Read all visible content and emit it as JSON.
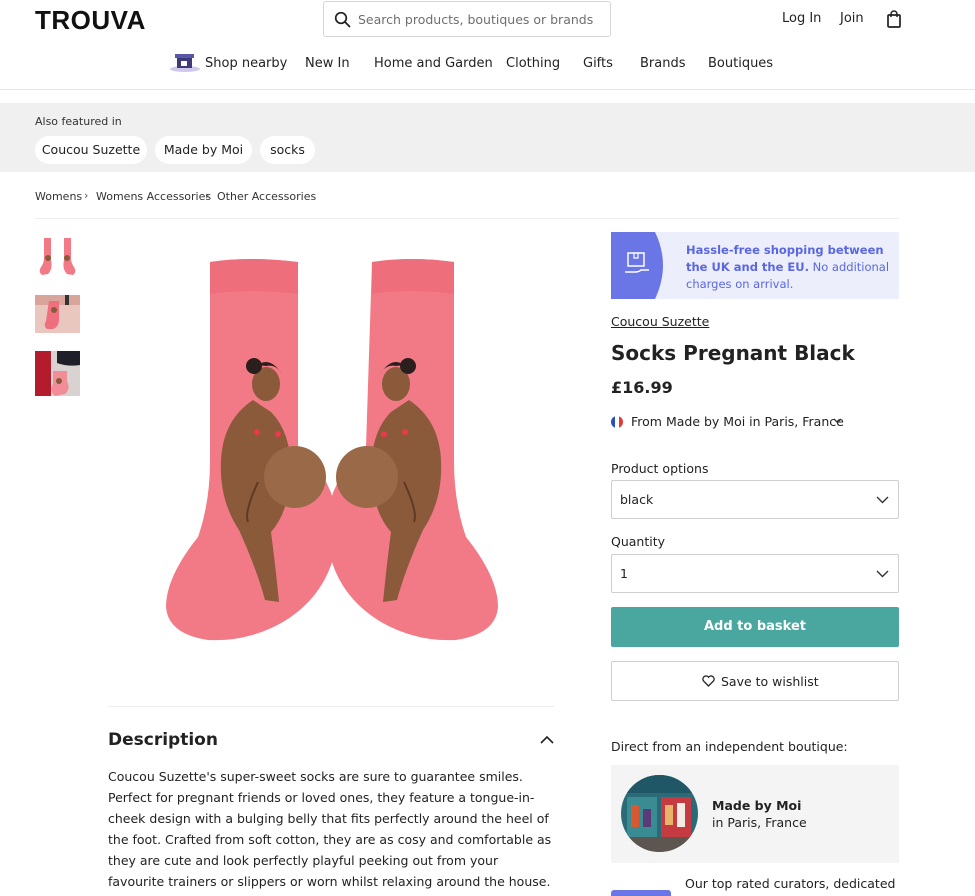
{
  "header": {
    "logo": "TROUVA",
    "search_placeholder": "Search products, boutiques or brands",
    "login": "Log In",
    "join": "Join",
    "icons": {
      "search": "search-icon",
      "bag": "shopping-bag-icon"
    }
  },
  "nav": {
    "items": [
      "Shop nearby",
      "New In",
      "Home and Garden",
      "Clothing",
      "Gifts",
      "Brands",
      "Boutiques"
    ]
  },
  "featured": {
    "label": "Also featured in",
    "chips": [
      "Coucou Suzette",
      "Made by Moi",
      "socks"
    ]
  },
  "breadcrumb": [
    "Womens",
    "Womens Accessories",
    "Other Accessories"
  ],
  "description": {
    "title": "Description",
    "body": "Coucou Suzette's super-sweet socks are sure to guarantee smiles. Perfect for pregnant friends or loved ones, they feature a tongue-in-cheek design with a bulging belly that fits perfectly around the heel of the foot. Crafted from soft cotton, they are as cosy and comfortable as they are cute and look perfectly playful peeking out from your favourite trainers or slippers or worn whilst relaxing around the house."
  },
  "promo": {
    "strong": "Hassle-free shopping between the UK and the EU.",
    "text": " No additional charges on arrival."
  },
  "product": {
    "brand": "Coucou Suzette",
    "title": "Socks Pregnant Black",
    "price": "£16.99",
    "origin": "From Made by Moi in Paris, France",
    "options_label": "Product options",
    "option_value": "black",
    "quantity_label": "Quantity",
    "quantity_value": "1",
    "add_to_basket": "Add to basket",
    "save_to_wishlist": "Save to wishlist"
  },
  "boutique": {
    "direct_label": "Direct from an independent boutique:",
    "name": "Made by Moi",
    "location": "in Paris, France",
    "curators_text": "Our top rated curators, dedicated to"
  },
  "colors": {
    "accent": "#4aa79f",
    "promo_bg": "#eceefc",
    "promo_text": "#5a67e0",
    "sock_pink": "#f27a86"
  }
}
